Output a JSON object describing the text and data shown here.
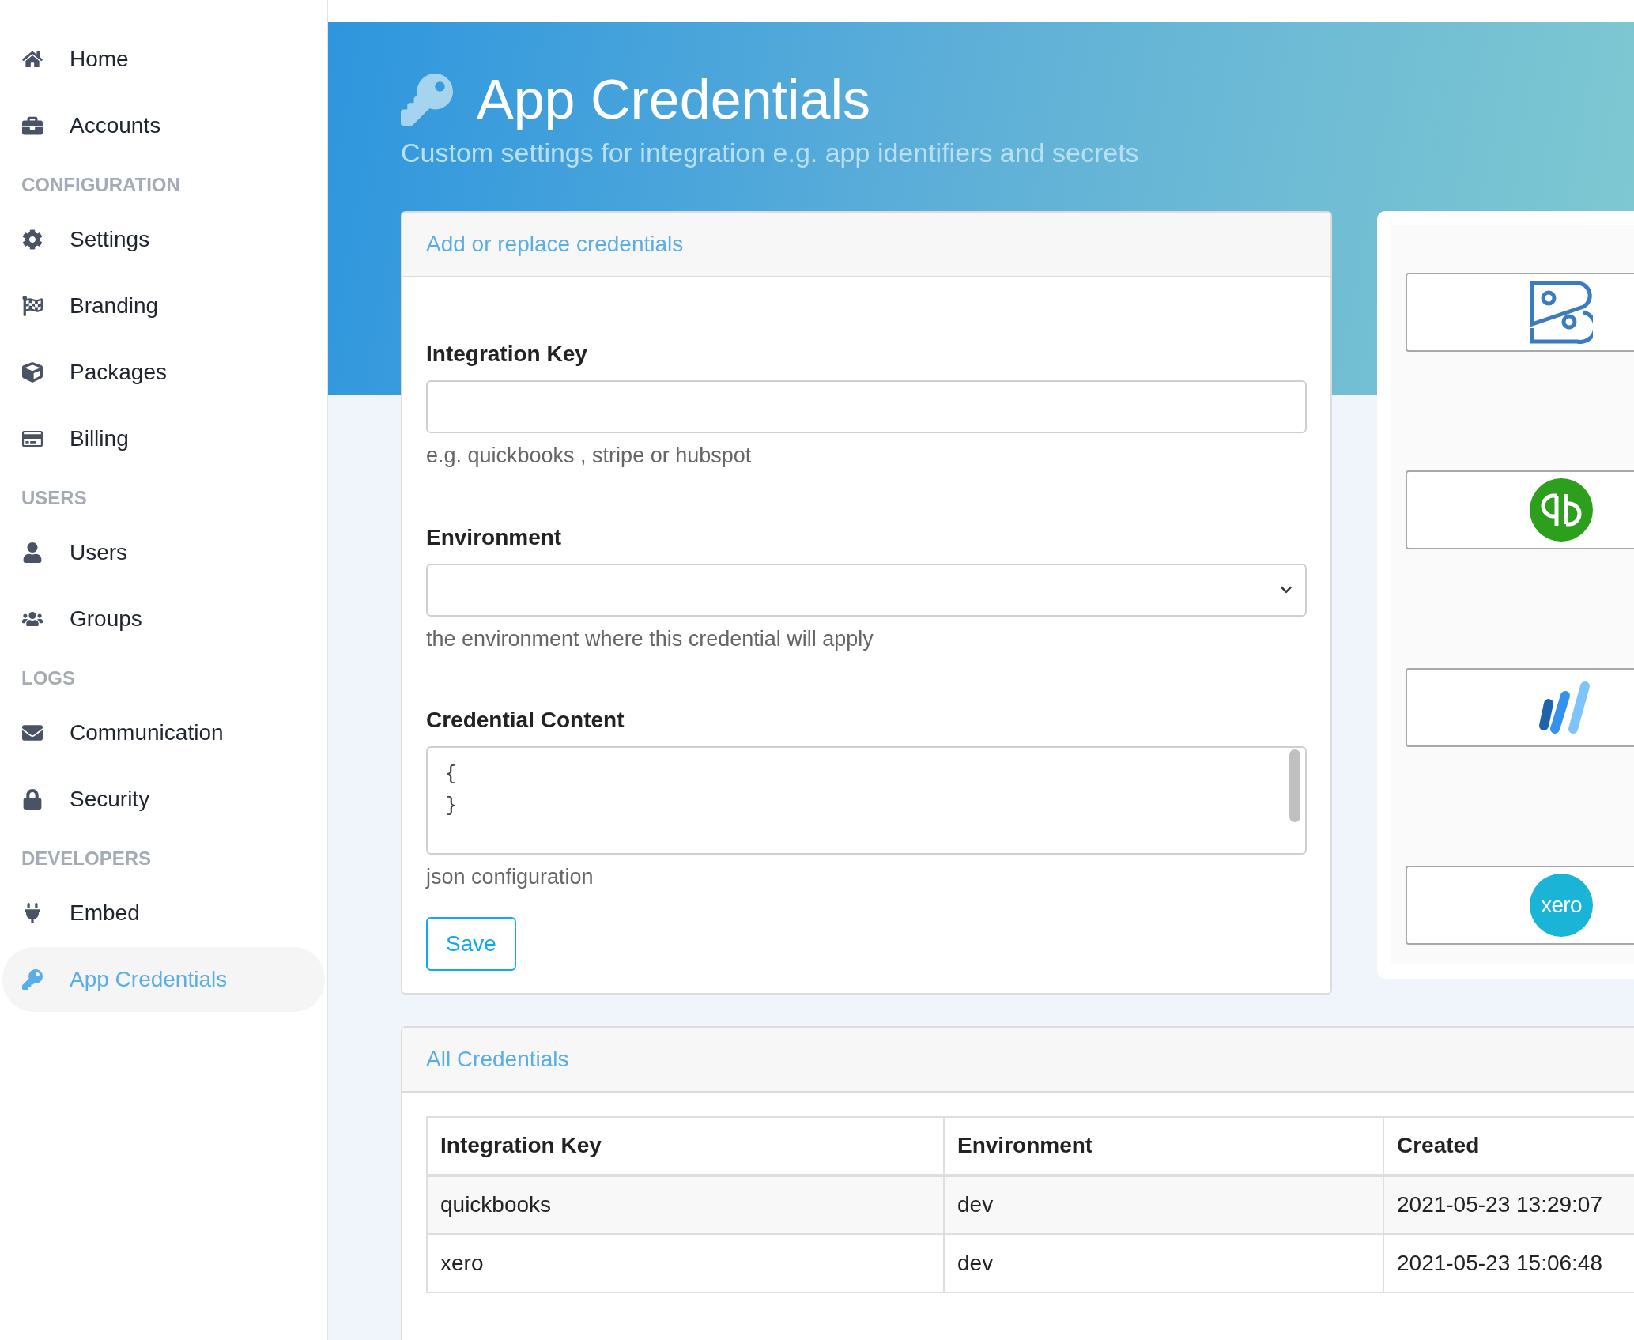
{
  "sidebar": {
    "sections": [
      {
        "items": [
          {
            "label": "Home",
            "selected": false
          },
          {
            "label": "Accounts",
            "selected": false
          }
        ]
      },
      {
        "heading": "CONFIGURATION",
        "items": [
          {
            "label": "Settings",
            "selected": false
          },
          {
            "label": "Branding",
            "selected": false
          },
          {
            "label": "Packages",
            "selected": false
          },
          {
            "label": "Billing",
            "selected": false
          }
        ]
      },
      {
        "heading": "USERS",
        "items": [
          {
            "label": "Users",
            "selected": false
          },
          {
            "label": "Groups",
            "selected": false
          }
        ]
      },
      {
        "heading": "LOGS",
        "items": [
          {
            "label": "Communication",
            "selected": false
          },
          {
            "label": "Security",
            "selected": false
          }
        ]
      },
      {
        "heading": "DEVELOPERS",
        "items": [
          {
            "label": "Embed",
            "selected": false
          },
          {
            "label": "App Credentials",
            "selected": true
          }
        ]
      }
    ]
  },
  "header": {
    "title": "App Credentials",
    "subtitle": "Custom settings for integration e.g. app identifiers and secrets"
  },
  "form": {
    "title": "Add or replace credentials",
    "fields": [
      {
        "kind": "text",
        "label": "Integration Key",
        "help": "e.g. quickbooks , stripe or hubspot"
      },
      {
        "kind": "select",
        "label": "Environment",
        "help": "the environment where this credential will apply"
      },
      {
        "kind": "textarea",
        "label": "Credential Content",
        "value": "{\n}",
        "help": "json configuration"
      }
    ],
    "button": "Save"
  },
  "integrations": [
    {
      "kind": "book"
    },
    {
      "kind": "qb"
    },
    {
      "kind": "wave"
    },
    {
      "kind": "xero",
      "text": "xero"
    }
  ],
  "table": {
    "title": "All Credentials",
    "columns": [
      "Integration Key",
      "Environment",
      "Created"
    ],
    "rows": [
      [
        "quickbooks",
        "dev",
        "2021-05-23 13:29:07"
      ],
      [
        "xero",
        "dev",
        "2021-05-23 15:06:48"
      ]
    ]
  }
}
